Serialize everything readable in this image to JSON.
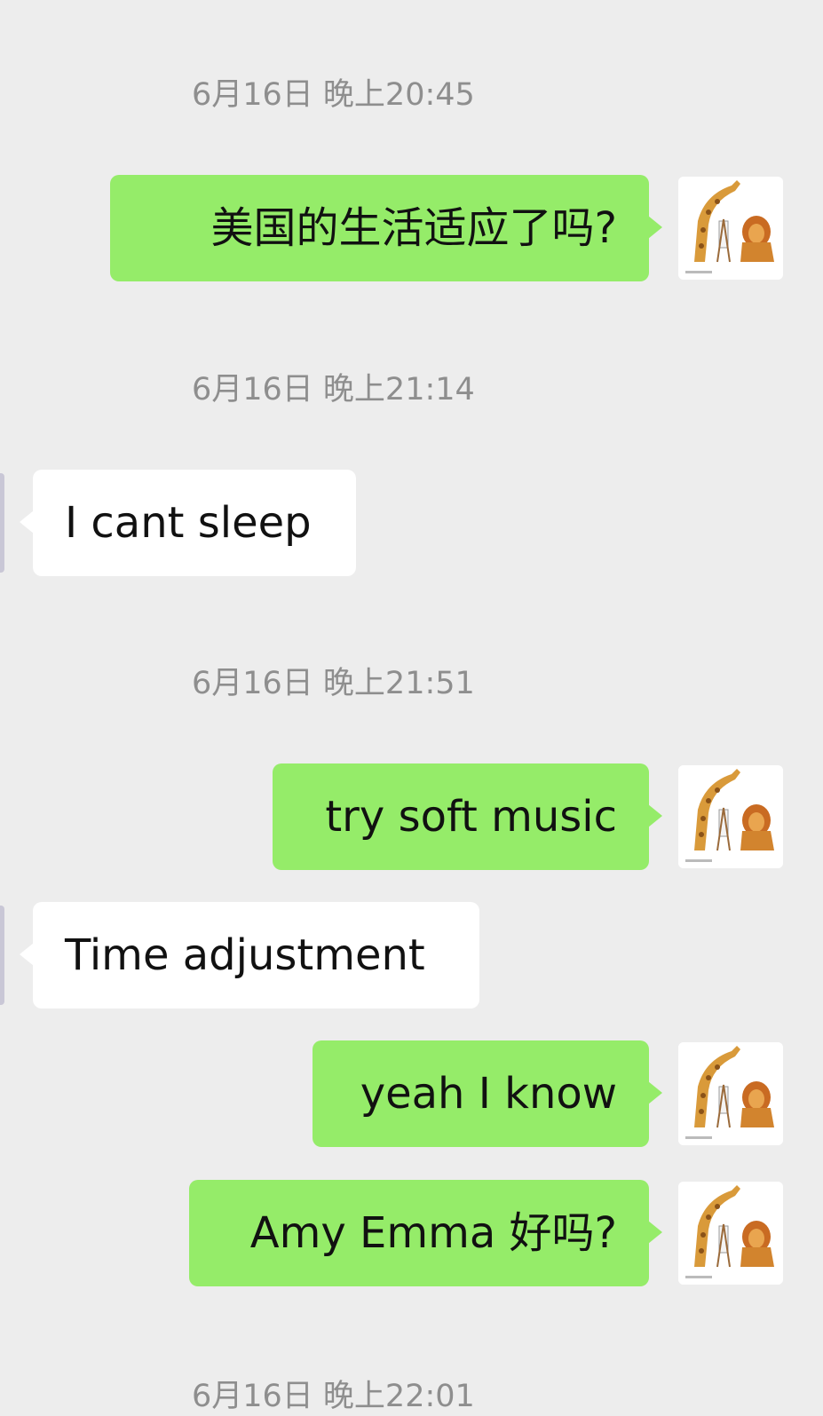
{
  "messages": [
    {
      "type": "timestamp",
      "text": "6月16日 晚上20:45"
    },
    {
      "type": "outgoing",
      "text": "美国的生活适应了吗?"
    },
    {
      "type": "timestamp",
      "text": "6月16日 晚上21:14"
    },
    {
      "type": "incoming",
      "text": "I cant sleep"
    },
    {
      "type": "timestamp",
      "text": "6月16日 晚上21:51"
    },
    {
      "type": "outgoing",
      "text": "try soft music"
    },
    {
      "type": "incoming",
      "text": "Time adjustment"
    },
    {
      "type": "outgoing",
      "text": "yeah I know"
    },
    {
      "type": "outgoing",
      "text": "Amy Emma 好吗?"
    },
    {
      "type": "timestamp",
      "text": "6月16日 晚上22:01"
    }
  ],
  "colors": {
    "background": "#ededed",
    "outgoing_bubble": "#95ec69",
    "incoming_bubble": "#ffffff",
    "timestamp_text": "#8e8e8e"
  },
  "icons": {
    "self_avatar": "giraffe-and-lion-painting-avatar-icon",
    "peer_avatar": "peer-avatar-icon"
  }
}
